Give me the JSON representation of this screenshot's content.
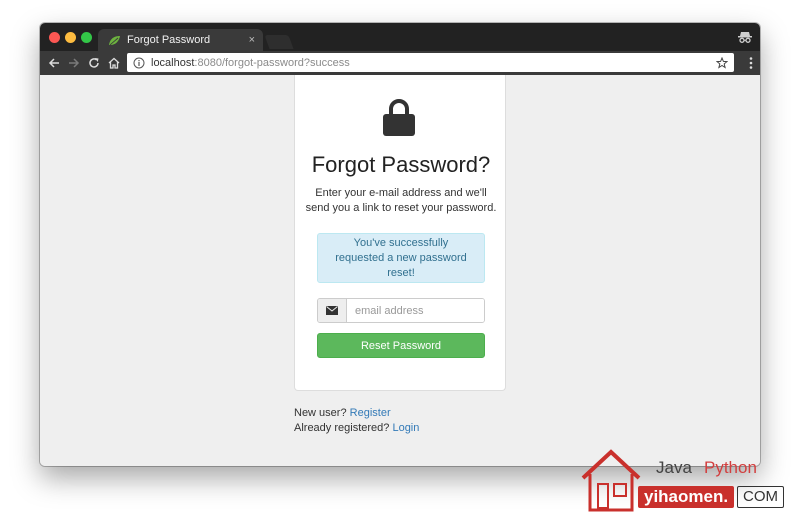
{
  "browser": {
    "tab_title": "Forgot Password",
    "tab_close": "×",
    "url_host": "localhost",
    "url_rest": ":8080/forgot-password?success"
  },
  "card": {
    "title": "Forgot Password?",
    "subtitle": "Enter your e-mail address and we'll send you a link to reset your password.",
    "alert": "You've successfully requested a new password reset!",
    "email_placeholder": "email address",
    "email_value": "",
    "reset_button": "Reset Password"
  },
  "links": {
    "new_user_prefix": "New user?",
    "register": "Register",
    "registered_prefix": "Already registered?",
    "login": "Login"
  },
  "watermark": {
    "word1": "Java",
    "word2": "Python",
    "domain": "yihaomen.",
    "tld": "COM"
  },
  "colors": {
    "success": "#5cb85c",
    "info_bg": "#d9edf7",
    "info_text": "#31708f",
    "link": "#337ab7"
  },
  "icons": [
    "leaf-icon",
    "incognito-icon",
    "back-icon",
    "forward-icon",
    "reload-icon",
    "home-icon",
    "info-icon",
    "star-icon",
    "menu-icon",
    "lock-icon",
    "envelope-icon"
  ]
}
